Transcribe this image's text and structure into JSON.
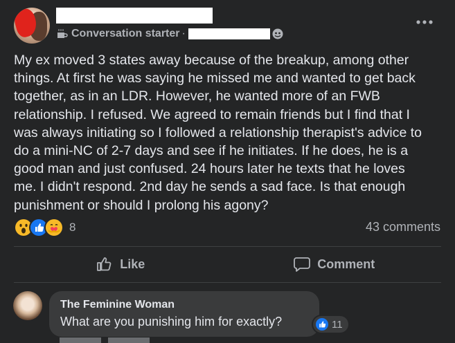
{
  "post": {
    "author_badge": "Conversation starter",
    "separator": "·",
    "body_lines": [
      "My ex moved 3 states away because of the breakup, among other",
      "things. At first he was saying he missed me and wanted to get back",
      "together, as in an LDR. However,  he wanted more of an FWB",
      "relationship. I refused. We agreed to remain friends but I find that I",
      "was always initiating so I followed a relationship therapist's advice to",
      "do a mini-NC of 2-7 days and see if he initiates. If he does, he is a",
      "good man and just confused. 24 hours later he texts that he loves",
      "me. I didn't respond. 2nd day he sends a sad face. Is that enough",
      "punishment or should I prolong his agony?"
    ],
    "reaction_icons": [
      "wow-reaction-icon",
      "like-reaction-icon",
      "care-reaction-icon"
    ],
    "reaction_count": "8",
    "comments_count": "43 comments"
  },
  "actions": {
    "like_label": "Like",
    "comment_label": "Comment"
  },
  "comment": {
    "author": "The Feminine Woman",
    "text": "What are you punishing him for exactly?",
    "like_count": "11"
  },
  "colors": {
    "background": "#242526",
    "bubble": "#3a3b3c",
    "text": "#e4e6eb",
    "secondary_text": "#b0b3b8",
    "like_blue": "#1877f2"
  }
}
